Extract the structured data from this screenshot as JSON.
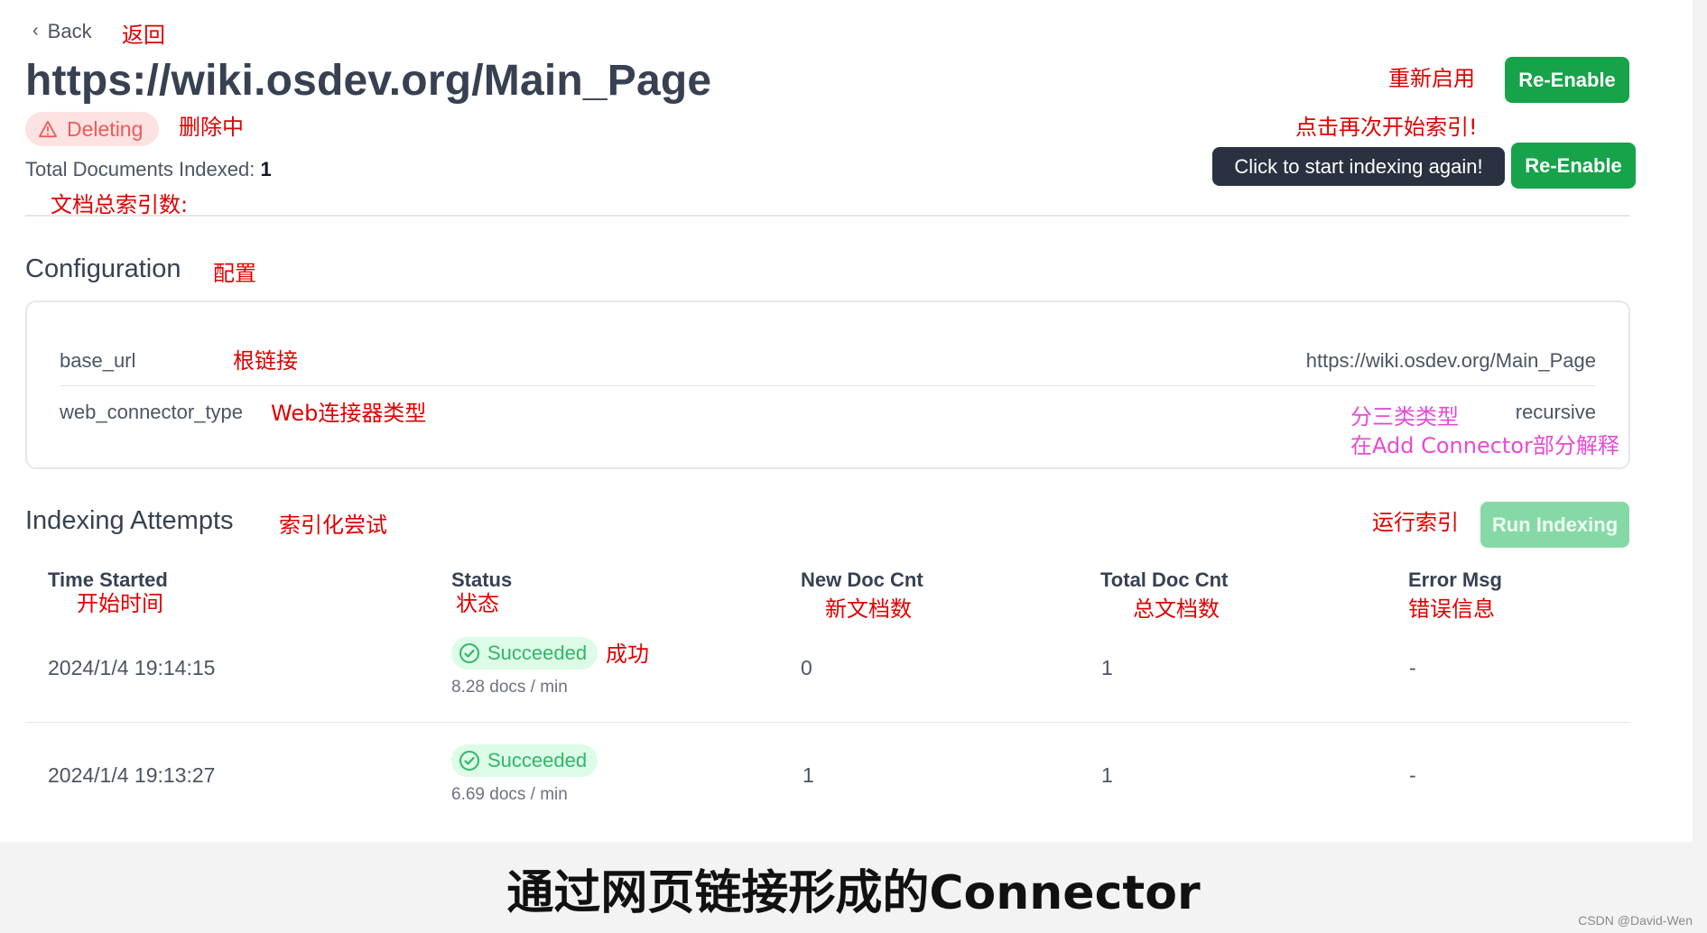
{
  "nav": {
    "back_label": "Back",
    "back_annotation": "返回"
  },
  "header": {
    "title": "https://wiki.osdev.org/Main_Page",
    "status_badge": "Deleting",
    "status_annotation": "删除中",
    "total_docs_label": "Total Documents Indexed:",
    "total_docs_value": "1",
    "total_docs_annotation": "文档总索引数:",
    "reenable_annotation": "重新启用",
    "reenable_label": "Re-Enable",
    "tooltip_annotation": "点击再次开始索引!",
    "tooltip_text": "Click to start indexing again!",
    "reenable_label_2": "Re-Enable"
  },
  "configuration": {
    "heading": "Configuration",
    "heading_annotation": "配置",
    "rows": [
      {
        "key": "base_url",
        "key_annotation": "根链接",
        "value": "https://wiki.osdev.org/Main_Page"
      },
      {
        "key": "web_connector_type",
        "key_annotation": "Web连接器类型",
        "value": "recursive",
        "value_annotation_1": "分三类类型",
        "value_annotation_2": "在Add Connector部分解释"
      }
    ]
  },
  "indexing": {
    "heading": "Indexing Attempts",
    "heading_annotation": "索引化尝试",
    "run_annotation": "运行索引",
    "run_label": "Run Indexing",
    "columns": [
      {
        "label": "Time Started",
        "annotation": "开始时间"
      },
      {
        "label": "Status",
        "annotation": "状态"
      },
      {
        "label": "New Doc Cnt",
        "annotation": "新文档数"
      },
      {
        "label": "Total Doc Cnt",
        "annotation": "总文档数"
      },
      {
        "label": "Error Msg",
        "annotation": "错误信息"
      }
    ],
    "rows": [
      {
        "time": "2024/1/4 19:14:15",
        "status": "Succeeded",
        "status_annotation": "成功",
        "rate": "8.28 docs / min",
        "new_docs": "0",
        "total_docs": "1",
        "error": "-"
      },
      {
        "time": "2024/1/4 19:13:27",
        "status": "Succeeded",
        "rate": "6.69 docs / min",
        "new_docs": "1",
        "total_docs": "1",
        "error": "-"
      }
    ]
  },
  "caption": "通过网页链接形成的Connector",
  "watermark": "CSDN @David-Wen",
  "colors": {
    "green": "#16a34a",
    "green_disabled": "#86d9a6",
    "annotation_red": "#e00000",
    "annotation_pink": "#e64bd3",
    "deleting_bg": "#fde2e2",
    "deleting_text": "#ef5a5a",
    "success_bg": "#dcfce7",
    "success_text": "#33b56a"
  }
}
